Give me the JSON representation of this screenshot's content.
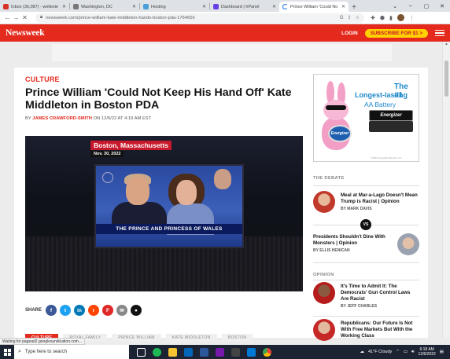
{
  "browser": {
    "tabs": [
      {
        "title": "Inbox (36,087) - wellesle",
        "fav": "#d93025"
      },
      {
        "title": "Washington, DC",
        "fav": "#777777"
      },
      {
        "title": "Hosting",
        "fav": "#4a9fd8"
      },
      {
        "title": "Dashboard | hPanel",
        "fav": "#673de6"
      },
      {
        "title": "Prince William 'Could No",
        "fav": "#1a73e8"
      }
    ],
    "url": "newsweek.com/prince-william-kate-middleton-hands-boston-pda-1764656"
  },
  "site": {
    "logo": "Newsweek",
    "login": "LOGIN",
    "subscribe": "SUBSCRIBE FOR $1 >"
  },
  "article": {
    "section": "CULTURE",
    "headline": "Prince William 'Could Not Keep His Hand Off' Kate Middleton in Boston PDA",
    "by": "BY",
    "author": "JAMES CRAWFORD-SMITH",
    "date": "ON 12/6/22 AT 4:19 AM EST",
    "video": {
      "location": "Boston, Massachusetts",
      "date": "Nov. 30, 2022",
      "caption": "THE PRINCE AND PRINCESS OF WALES"
    },
    "share_label": "SHARE",
    "tags": [
      "CULTURE",
      "ROYAL FAMILY",
      "PRINCE WILLIAM",
      "KATE MIDDLETON",
      "BOSTON"
    ]
  },
  "ad": {
    "line1": "The #1",
    "line2": "Longest-lasting",
    "line3": "AA Battery",
    "battery_brand": "Energizer",
    "drum_brand": "Energizer",
    "fine": "©2022 Energizer Brands, LLC"
  },
  "sidebar": {
    "debate_head": "THE DEBATE",
    "debate": [
      {
        "title": "Meal at Mar-a-Lago Doesn't Mean Trump is Racist | Opinion",
        "by": "BY MARK DAVIS"
      },
      {
        "title": "Presidents Shouldn't Dine With Monsters | Opinion",
        "by": "BY ELLIS HENICAN"
      }
    ],
    "vs": "VS",
    "opinion_head": "OPINION",
    "opinion": [
      {
        "title": "It's Time to Admit It: The Democrats' Gun Control Laws Are Racist",
        "by": "BY JEFF CHARLES"
      },
      {
        "title": "Republicans: Our Future Is Not With Free Markets But With the Working Class",
        "by": ""
      }
    ]
  },
  "status": "Waiting for pagead2.googlesyndication.com...",
  "taskbar": {
    "search_placeholder": "Type here to search",
    "weather": "41°F  Cloudy",
    "time": "6:18 AM",
    "date": "12/6/2022"
  }
}
